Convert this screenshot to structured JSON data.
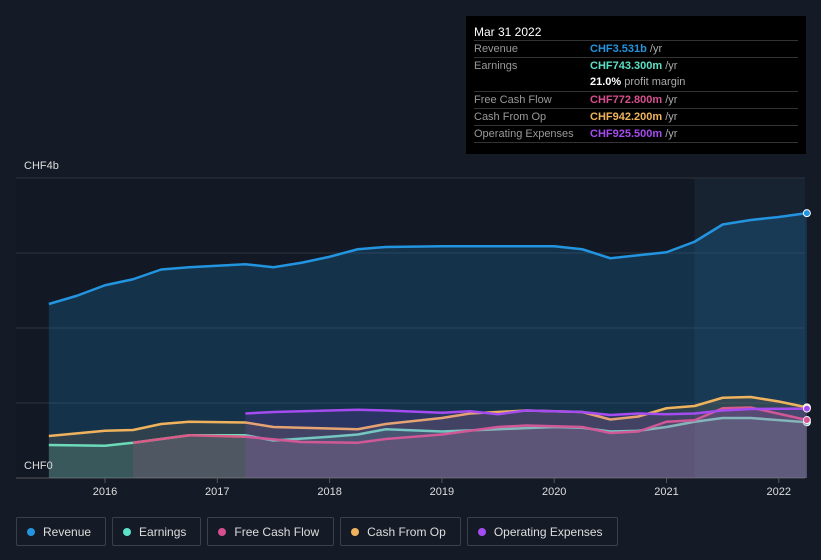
{
  "tooltip": {
    "date": "Mar 31 2022",
    "rows": [
      {
        "label": "Revenue",
        "value": "CHF3.531b",
        "unit": " /yr",
        "color": "#2394df"
      },
      {
        "label": "Earnings",
        "value": "CHF743.300m",
        "unit": " /yr",
        "color": "#5ce1c6"
      },
      {
        "label": "",
        "value": "21.0%",
        "unit": " profit margin",
        "color": "#ffffff"
      },
      {
        "label": "Free Cash Flow",
        "value": "CHF772.800m",
        "unit": " /yr",
        "color": "#d64f8e"
      },
      {
        "label": "Cash From Op",
        "value": "CHF942.200m",
        "unit": " /yr",
        "color": "#f0b35d"
      },
      {
        "label": "Operating Expenses",
        "value": "CHF925.500m",
        "unit": " /yr",
        "color": "#a54cf0"
      }
    ]
  },
  "chart_data": {
    "type": "area",
    "ylabels": {
      "top": "CHF4b",
      "bottom": "CHF0"
    },
    "ylim": [
      0,
      4
    ],
    "xlim": [
      2015.4,
      2022.25
    ],
    "xticks": [
      "2016",
      "2017",
      "2018",
      "2019",
      "2020",
      "2021",
      "2022"
    ],
    "grid": true,
    "legend": "bottom-left",
    "series": [
      {
        "name": "Revenue",
        "color": "#2394df",
        "x": [
          2015.5,
          2015.75,
          2016,
          2016.25,
          2016.5,
          2016.75,
          2017,
          2017.25,
          2017.5,
          2017.75,
          2018,
          2018.25,
          2018.5,
          2019,
          2019.5,
          2020,
          2020.25,
          2020.5,
          2020.75,
          2021,
          2021.25,
          2021.5,
          2021.75,
          2022,
          2022.25
        ],
        "y": [
          2.32,
          2.43,
          2.57,
          2.65,
          2.78,
          2.81,
          2.83,
          2.85,
          2.81,
          2.87,
          2.95,
          3.05,
          3.08,
          3.09,
          3.09,
          3.09,
          3.05,
          2.93,
          2.97,
          3.01,
          3.15,
          3.38,
          3.44,
          3.48,
          3.531
        ]
      },
      {
        "name": "Earnings",
        "color": "#5ce1c6",
        "x": [
          2015.5,
          2016,
          2016.25,
          2016.75,
          2017.25,
          2017.5,
          2018,
          2018.25,
          2018.5,
          2019,
          2019.5,
          2020,
          2020.25,
          2020.5,
          2020.75,
          2021,
          2021.25,
          2021.5,
          2021.75,
          2022.25
        ],
        "y": [
          0.44,
          0.43,
          0.47,
          0.57,
          0.57,
          0.5,
          0.55,
          0.58,
          0.65,
          0.62,
          0.65,
          0.68,
          0.67,
          0.62,
          0.63,
          0.68,
          0.75,
          0.8,
          0.8,
          0.743
        ]
      },
      {
        "name": "Free Cash Flow",
        "color": "#d64f8e",
        "x": [
          2016.25,
          2016.75,
          2017.25,
          2017.75,
          2018.25,
          2018.5,
          2019,
          2019.5,
          2019.75,
          2020.25,
          2020.5,
          2020.75,
          2021,
          2021.25,
          2021.5,
          2021.75,
          2022.25
        ],
        "y": [
          0.47,
          0.57,
          0.55,
          0.48,
          0.47,
          0.52,
          0.58,
          0.68,
          0.7,
          0.68,
          0.6,
          0.62,
          0.75,
          0.77,
          0.93,
          0.94,
          0.773
        ]
      },
      {
        "name": "Cash From Op",
        "color": "#f0b35d",
        "x": [
          2015.5,
          2016,
          2016.25,
          2016.5,
          2016.75,
          2017.25,
          2017.5,
          2018,
          2018.25,
          2018.5,
          2019,
          2019.25,
          2019.75,
          2020.25,
          2020.5,
          2020.75,
          2021,
          2021.25,
          2021.5,
          2021.75,
          2022,
          2022.25
        ],
        "y": [
          0.56,
          0.63,
          0.64,
          0.72,
          0.75,
          0.74,
          0.68,
          0.66,
          0.65,
          0.72,
          0.8,
          0.86,
          0.9,
          0.88,
          0.78,
          0.82,
          0.93,
          0.96,
          1.07,
          1.08,
          1.02,
          0.942
        ]
      },
      {
        "name": "Operating Expenses",
        "color": "#a54cf0",
        "x": [
          2017.25,
          2017.5,
          2018,
          2018.25,
          2018.5,
          2019,
          2019.25,
          2019.5,
          2019.75,
          2020.25,
          2020.5,
          2020.75,
          2021,
          2021.25,
          2021.5,
          2021.75,
          2022.25
        ],
        "y": [
          0.86,
          0.88,
          0.9,
          0.91,
          0.9,
          0.87,
          0.89,
          0.85,
          0.9,
          0.88,
          0.84,
          0.86,
          0.85,
          0.86,
          0.9,
          0.92,
          0.9255
        ]
      }
    ],
    "highlight_from": 2021.25
  }
}
